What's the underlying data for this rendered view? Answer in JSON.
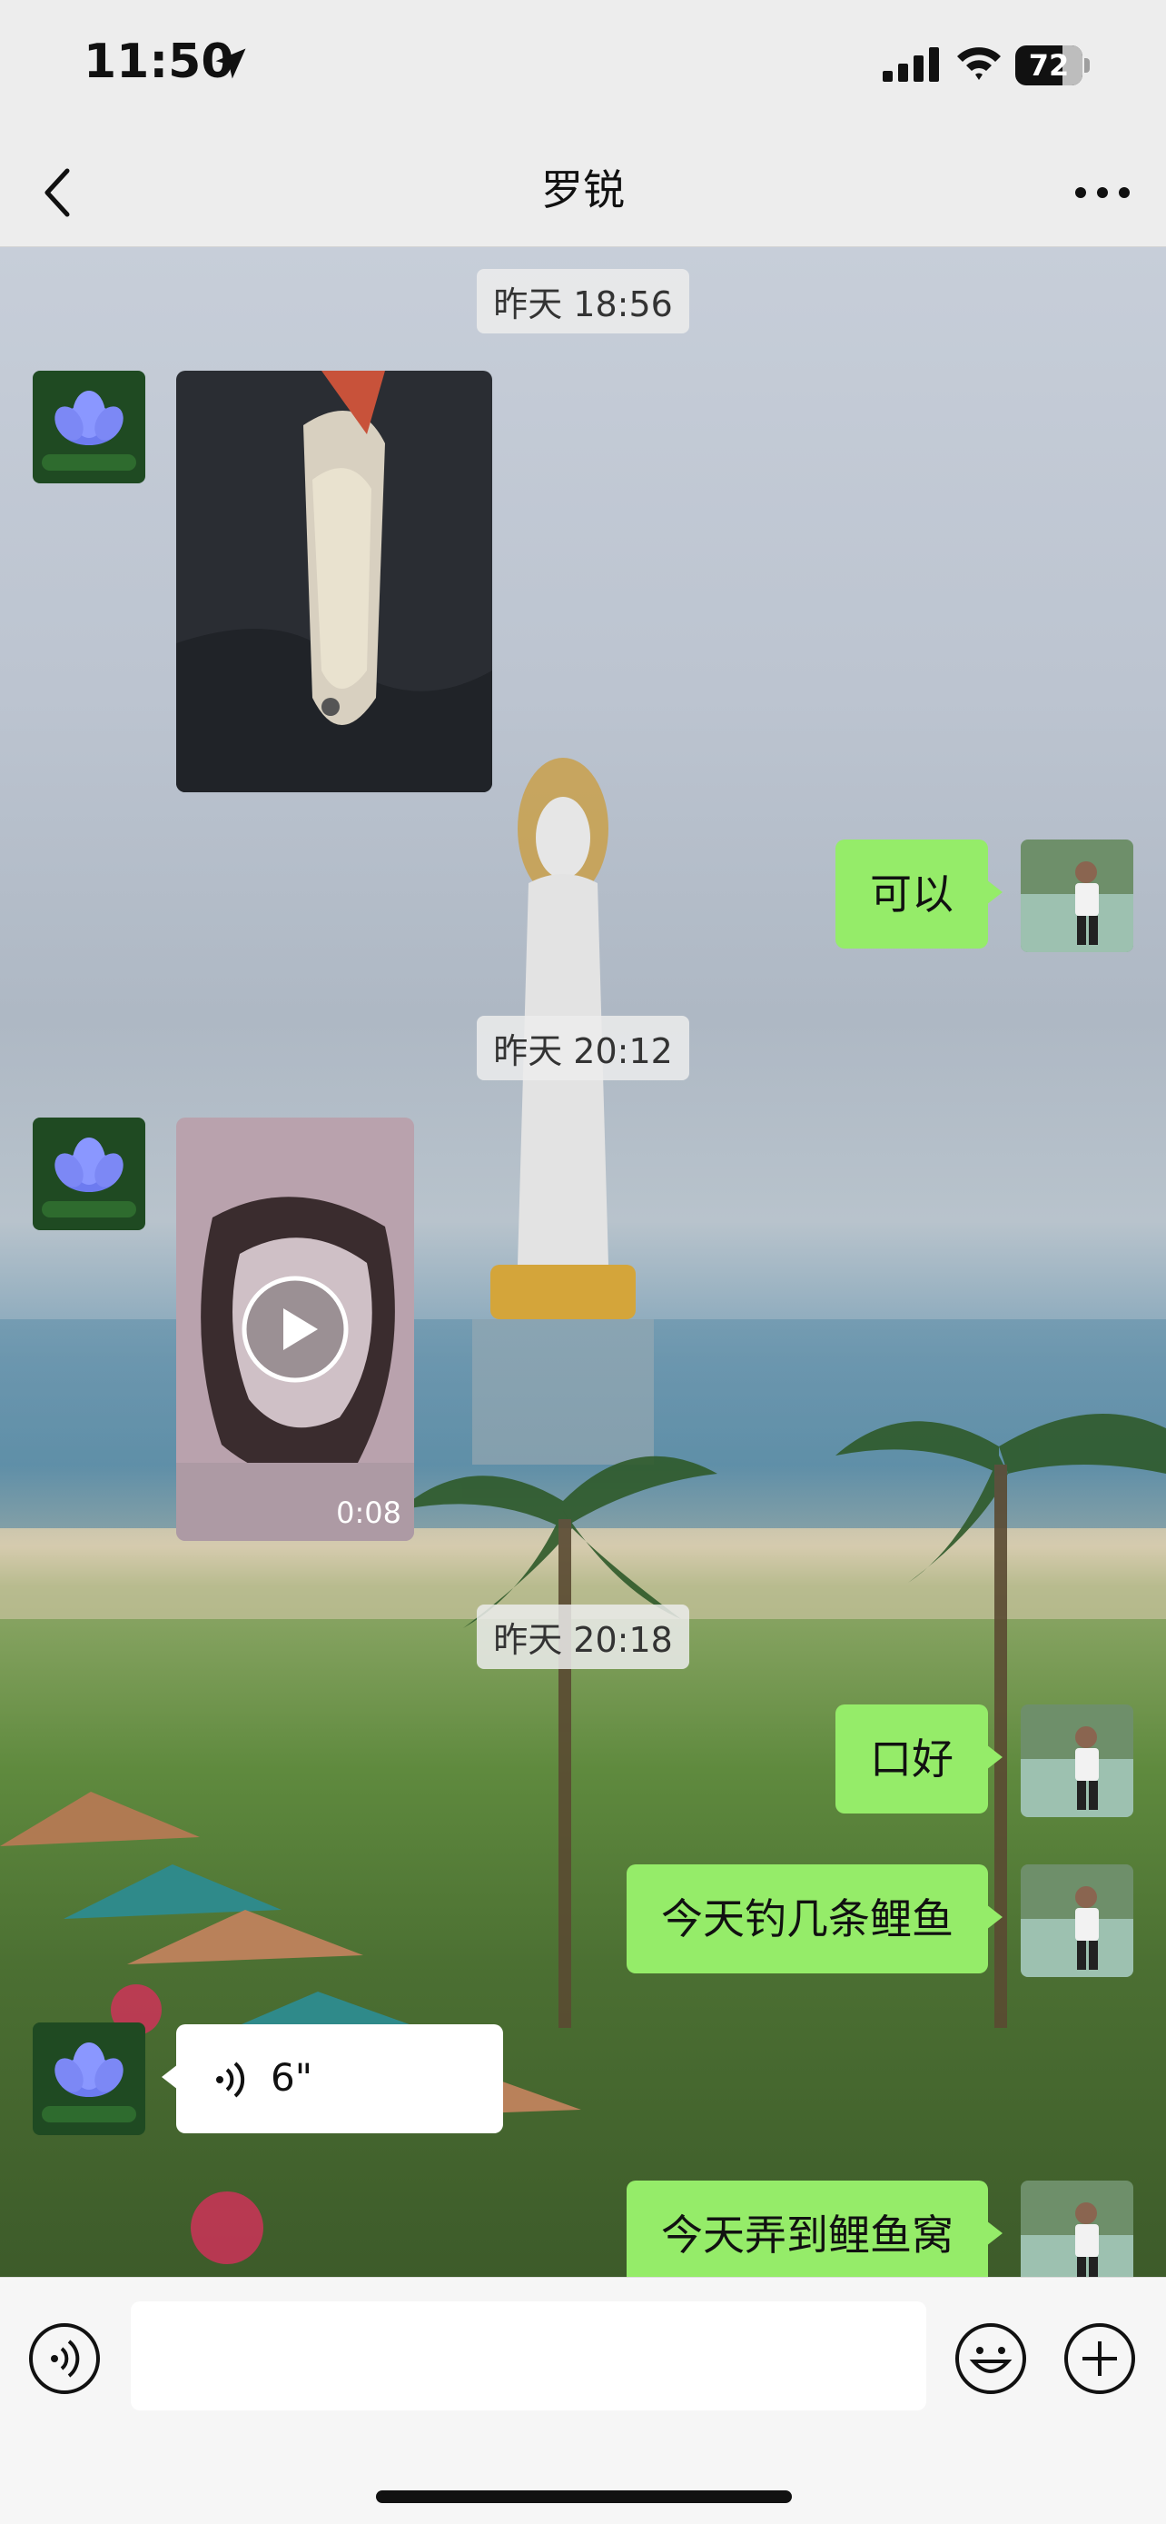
{
  "status_bar": {
    "time": "11:50",
    "battery": "72"
  },
  "nav": {
    "title": "罗锐"
  },
  "messages": {
    "ts1": "昨天 18:56",
    "reply1": "可以",
    "ts2": "昨天 20:12",
    "video_duration": "0:08",
    "ts3": "昨天 20:18",
    "reply2": "口好",
    "reply3": "今天钓几条鲤鱼",
    "voice_duration": "6\"",
    "reply4": "今天弄到鲤鱼窝"
  },
  "input": {
    "value": ""
  },
  "colors": {
    "sent_bubble": "#95ec69",
    "received_bubble": "#ffffff",
    "background": "#ededed"
  },
  "icons": [
    "location-arrow-icon",
    "signal-icon",
    "wifi-icon",
    "battery-icon",
    "back-icon",
    "more-icon",
    "play-icon",
    "voice-wave-icon",
    "voice-toggle-icon",
    "emoji-icon",
    "plus-icon"
  ]
}
